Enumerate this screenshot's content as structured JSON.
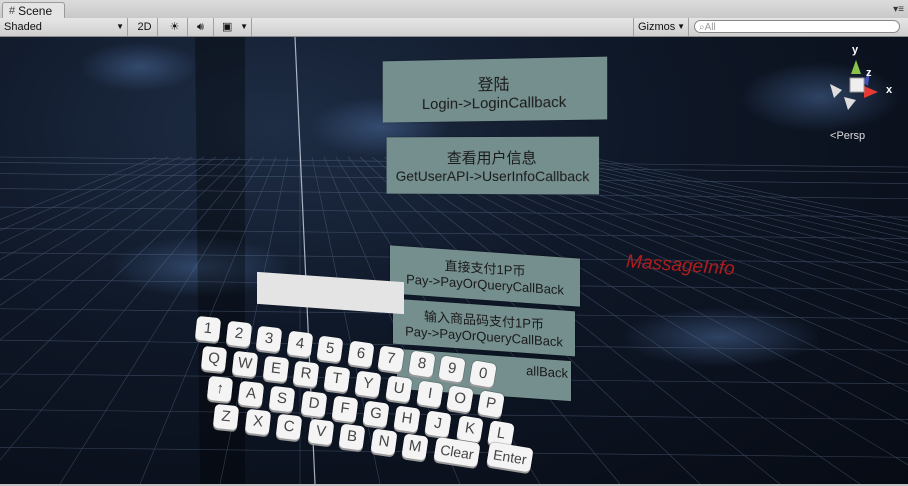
{
  "window": {
    "tab_title": "Scene"
  },
  "toolbar": {
    "shading_mode": "Shaded",
    "mode_2d": "2D",
    "gizmos": "Gizmos",
    "search_placeholder": "All"
  },
  "scene": {
    "buttons": [
      {
        "line1": "登陆",
        "line2": "Login->LoginCallback"
      },
      {
        "line1": "查看用户信息",
        "line2": "GetUserAPI->UserInfoCallback"
      },
      {
        "line1": "直接支付1P币",
        "line2": "Pay->PayOrQueryCallBack"
      },
      {
        "line1": "输入商品码支付1P币",
        "line2": "Pay->PayOrQueryCallBack"
      },
      {
        "line1": "",
        "line2": "allBack"
      }
    ],
    "massage_label": "MassageInfo",
    "gizmo": {
      "y": "y",
      "z": "z",
      "x": "x",
      "projection": "Persp"
    },
    "keyboard": {
      "row1": [
        "1",
        "2",
        "3",
        "4",
        "5",
        "6",
        "7",
        "8",
        "9",
        "0"
      ],
      "row2": [
        "Q",
        "W",
        "E",
        "R",
        "T",
        "Y",
        "U",
        "I",
        "O",
        "P"
      ],
      "row3": [
        "↑",
        "A",
        "S",
        "D",
        "F",
        "G",
        "H",
        "J",
        "K",
        "L"
      ],
      "row4": [
        "Z",
        "X",
        "C",
        "V",
        "B",
        "N",
        "M",
        "Clear",
        "Enter"
      ]
    }
  }
}
